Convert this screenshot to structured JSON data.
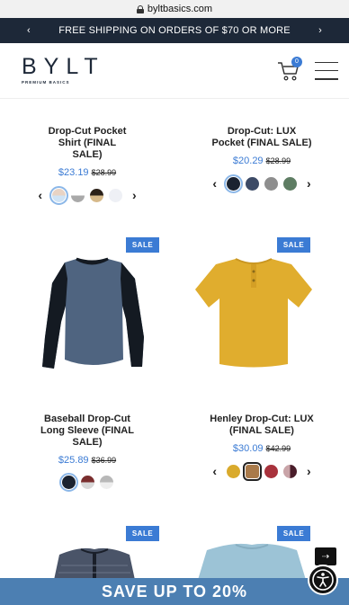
{
  "browser": {
    "url": "byltbasics.com"
  },
  "promo": {
    "prev": "‹",
    "text": "FREE SHIPPING ON ORDERS OF $70 OR MORE",
    "next": "›"
  },
  "header": {
    "logo": "BYLT",
    "logo_tagline": "PREMIUM BASICS",
    "cart_count": "0"
  },
  "products": [
    {
      "name": "Drop-Cut Pocket Shirt (FINAL SALE)",
      "price": "$23.19",
      "old_price": "$28.99",
      "sale": false,
      "swatches": [
        "#e8d3c4",
        "#a9a9a9",
        "#2b2119",
        "#eef0f5"
      ],
      "has_arrows": true
    },
    {
      "name": "Drop-Cut: LUX Pocket (FINAL SALE)",
      "price": "$20.29",
      "old_price": "$28.99",
      "sale": false,
      "swatches": [
        "#1a2230",
        "#3c4a66",
        "#8e8e8e",
        "#5e7d63"
      ],
      "has_arrows": true
    },
    {
      "name": "Baseball Drop-Cut Long Sleeve (FINAL SALE)",
      "price": "$25.89",
      "old_price": "$36.99",
      "sale": true,
      "swatches": [
        "#1b2330",
        "#7a2e2e",
        "#b8b8b8"
      ],
      "has_arrows": false
    },
    {
      "name": "Henley Drop-Cut: LUX (FINAL SALE)",
      "price": "$30.09",
      "old_price": "$42.99",
      "sale": true,
      "swatches": [
        "#d9aa2c",
        "#a97a4a",
        "#a8323c",
        "#4a1d2a"
      ],
      "has_arrows": true
    }
  ],
  "sale_label": "SALE",
  "chevrons": {
    "left": "‹",
    "right": "›"
  },
  "banner": {
    "text": "SAVE UP TO 20%"
  },
  "colors": {
    "accent": "#3b7bd4",
    "navy": "#1d2838",
    "banner": "#4c7fb2"
  }
}
